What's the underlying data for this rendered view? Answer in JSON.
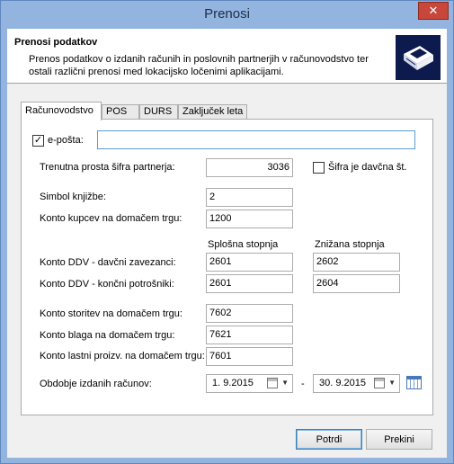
{
  "window": {
    "title": "Prenosi",
    "close_glyph": "✕"
  },
  "header": {
    "title": "Prenosi podatkov",
    "description": "Prenos podatkov o izdanih računih in poslovnih partnerjih v računovodstvo ter ostali različni prenosi med lokacijsko ločenimi aplikacijami.",
    "icon": "printer-icon"
  },
  "tabs": [
    {
      "label": "Računovodstvo",
      "active": true
    },
    {
      "label": "POS",
      "active": false
    },
    {
      "label": "DURS",
      "active": false
    },
    {
      "label": "Zaključek leta",
      "active": false
    }
  ],
  "form": {
    "email_checkbox_label": "e-pošta:",
    "email_checked": true,
    "email_value": "",
    "partner_code_label": "Trenutna prosta šifra partnerja:",
    "partner_code_value": "3036",
    "tax_number_checkbox_label": "Šifra je davčna št.",
    "tax_number_checked": false,
    "book_symbol_label": "Simbol knjižbe:",
    "book_symbol_value": "2",
    "customer_account_label": "Konto kupcev na domačem trgu:",
    "customer_account_value": "1200",
    "general_rate_header": "Splošna stopnja",
    "reduced_rate_header": "Znižana stopnja",
    "vat_taxpayers_label": "Konto DDV - davčni zavezanci:",
    "vat_taxpayers_general": "2601",
    "vat_taxpayers_reduced": "2602",
    "vat_consumers_label": "Konto DDV - končni potrošniki:",
    "vat_consumers_general": "2601",
    "vat_consumers_reduced": "2604",
    "services_account_label": "Konto storitev na domačem trgu:",
    "services_account_value": "7602",
    "goods_account_label": "Konto blaga na domačem trgu:",
    "goods_account_value": "7621",
    "own_products_account_label": "Konto lastni proizv. na domačem trgu:",
    "own_products_account_value": "7601",
    "period_label": "Obdobje izdanih računov:",
    "period_from": "1.  9.2015",
    "period_separator": "-",
    "period_to": "30.  9.2015"
  },
  "buttons": {
    "confirm": "Potrdi",
    "cancel": "Prekini"
  }
}
